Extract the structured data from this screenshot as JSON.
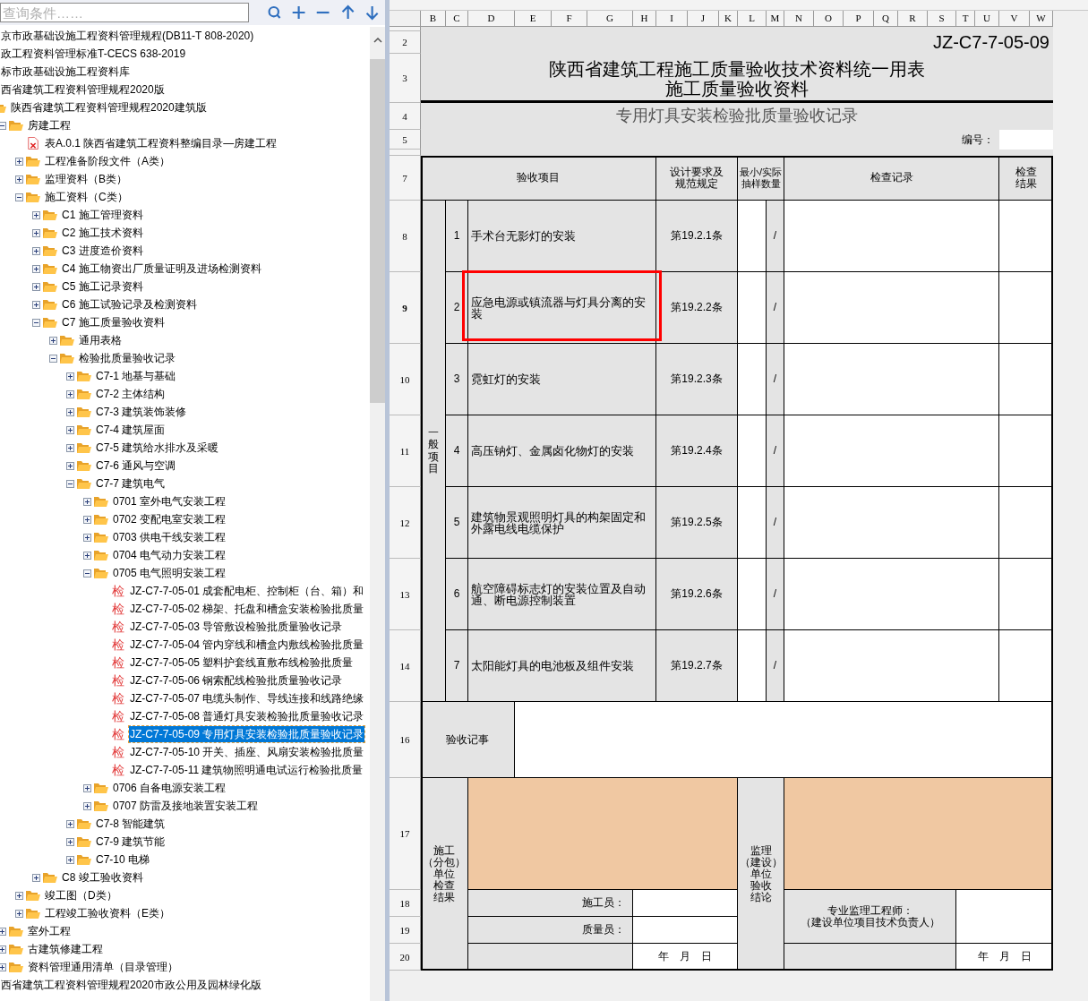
{
  "search": {
    "placeholder": "查询条件……"
  },
  "tree": [
    {
      "kind": "root",
      "label": "京市政基础设施工程资料管理规程(DB11-T 808-2020)",
      "selected": false
    },
    {
      "kind": "root",
      "label": "政工程资料管理标准T-CECS 638-2019",
      "selected": false
    },
    {
      "kind": "root",
      "label": "标市政基础设施工程资料库",
      "selected": false
    },
    {
      "kind": "root",
      "label": "西省建筑工程资料管理规程2020版",
      "selected": false
    },
    {
      "kind": "folder",
      "label": "陕西省建筑工程资料管理规程2020建筑版",
      "selected": false,
      "children": [
        {
          "kind": "folder",
          "label": "房建工程",
          "expanded": true,
          "selected": false,
          "children": [
            {
              "kind": "file",
              "label": "表A.0.1 陕西省建筑工程资料整编目录—房建工程",
              "selected": false
            },
            {
              "kind": "folder",
              "label": "工程准备阶段文件（A类）",
              "expanded": false,
              "selected": false
            },
            {
              "kind": "folder",
              "label": "监理资料（B类）",
              "expanded": false,
              "selected": false
            },
            {
              "kind": "folder",
              "label": "施工资料（C类）",
              "expanded": true,
              "selected": false,
              "children": [
                {
                  "kind": "folder",
                  "label": "C1 施工管理资料",
                  "expanded": false,
                  "selected": false
                },
                {
                  "kind": "folder",
                  "label": "C2 施工技术资料",
                  "expanded": false,
                  "selected": false
                },
                {
                  "kind": "folder",
                  "label": "C3 进度造价资料",
                  "expanded": false,
                  "selected": false
                },
                {
                  "kind": "folder",
                  "label": "C4 施工物资出厂质量证明及进场检测资料",
                  "expanded": false,
                  "selected": false
                },
                {
                  "kind": "folder",
                  "label": "C5 施工记录资料",
                  "expanded": false,
                  "selected": false
                },
                {
                  "kind": "folder",
                  "label": "C6 施工试验记录及检测资料",
                  "expanded": false,
                  "selected": false
                },
                {
                  "kind": "folder",
                  "label": "C7 施工质量验收资料",
                  "expanded": true,
                  "selected": false,
                  "children": [
                    {
                      "kind": "folder",
                      "label": "通用表格",
                      "expanded": false,
                      "selected": false
                    },
                    {
                      "kind": "folder",
                      "label": "检验批质量验收记录",
                      "expanded": true,
                      "selected": false,
                      "children": [
                        {
                          "kind": "folder",
                          "label": "C7-1 地基与基础",
                          "expanded": false,
                          "selected": false
                        },
                        {
                          "kind": "folder",
                          "label": "C7-2 主体结构",
                          "expanded": false,
                          "selected": false
                        },
                        {
                          "kind": "folder",
                          "label": "C7-3 建筑装饰装修",
                          "expanded": false,
                          "selected": false
                        },
                        {
                          "kind": "folder",
                          "label": "C7-4 建筑屋面",
                          "expanded": false,
                          "selected": false
                        },
                        {
                          "kind": "folder",
                          "label": "C7-5 建筑给水排水及采暖",
                          "expanded": false,
                          "selected": false
                        },
                        {
                          "kind": "folder",
                          "label": "C7-6 通风与空调",
                          "expanded": false,
                          "selected": false
                        },
                        {
                          "kind": "folder",
                          "label": "C7-7 建筑电气",
                          "expanded": true,
                          "selected": false,
                          "children": [
                            {
                              "kind": "folder",
                              "label": "0701 室外电气安装工程",
                              "expanded": false,
                              "selected": false
                            },
                            {
                              "kind": "folder",
                              "label": "0702 变配电室安装工程",
                              "expanded": false,
                              "selected": false
                            },
                            {
                              "kind": "folder",
                              "label": "0703 供电干线安装工程",
                              "expanded": false,
                              "selected": false
                            },
                            {
                              "kind": "folder",
                              "label": "0704 电气动力安装工程",
                              "expanded": false,
                              "selected": false
                            },
                            {
                              "kind": "folder",
                              "label": "0705 电气照明安装工程",
                              "expanded": true,
                              "selected": false,
                              "children": [
                                {
                                  "kind": "check",
                                  "badge": "检",
                                  "label": "JZ-C7-7-05-01 成套配电柜、控制柜（台、箱）和",
                                  "selected": false
                                },
                                {
                                  "kind": "check",
                                  "badge": "检",
                                  "label": "JZ-C7-7-05-02 梯架、托盘和槽盒安装检验批质量",
                                  "selected": false
                                },
                                {
                                  "kind": "check",
                                  "badge": "检",
                                  "label": "JZ-C7-7-05-03 导管敷设检验批质量验收记录",
                                  "selected": false
                                },
                                {
                                  "kind": "check",
                                  "badge": "检",
                                  "label": "JZ-C7-7-05-04 管内穿线和槽盒内敷线检验批质量",
                                  "selected": false
                                },
                                {
                                  "kind": "check",
                                  "badge": "检",
                                  "label": "JZ-C7-7-05-05 塑料护套线直敷布线检验批质量",
                                  "selected": false
                                },
                                {
                                  "kind": "check",
                                  "badge": "检",
                                  "label": "JZ-C7-7-05-06 钢索配线检验批质量验收记录",
                                  "selected": false
                                },
                                {
                                  "kind": "check",
                                  "badge": "检",
                                  "label": "JZ-C7-7-05-07 电缆头制作、导线连接和线路绝缘",
                                  "selected": false
                                },
                                {
                                  "kind": "check",
                                  "badge": "检",
                                  "label": "JZ-C7-7-05-08 普通灯具安装检验批质量验收记录",
                                  "selected": false
                                },
                                {
                                  "kind": "check",
                                  "badge": "检",
                                  "label": "JZ-C7-7-05-09 专用灯具安装检验批质量验收记录",
                                  "selected": true
                                },
                                {
                                  "kind": "check",
                                  "badge": "检",
                                  "label": "JZ-C7-7-05-10 开关、插座、风扇安装检验批质量",
                                  "selected": false
                                },
                                {
                                  "kind": "check",
                                  "badge": "检",
                                  "label": "JZ-C7-7-05-11 建筑物照明通电试运行检验批质量",
                                  "selected": false
                                }
                              ]
                            },
                            {
                              "kind": "folder",
                              "label": "0706 自备电源安装工程",
                              "expanded": false,
                              "selected": false
                            },
                            {
                              "kind": "folder",
                              "label": "0707 防雷及接地装置安装工程",
                              "expanded": false,
                              "selected": false
                            }
                          ]
                        },
                        {
                          "kind": "folder",
                          "label": "C7-8 智能建筑",
                          "expanded": false,
                          "selected": false
                        },
                        {
                          "kind": "folder",
                          "label": "C7-9 建筑节能",
                          "expanded": false,
                          "selected": false
                        },
                        {
                          "kind": "folder",
                          "label": "C7-10 电梯",
                          "expanded": false,
                          "selected": false
                        }
                      ]
                    }
                  ]
                },
                {
                  "kind": "folder",
                  "label": "C8 竣工验收资料",
                  "expanded": false,
                  "selected": false
                }
              ]
            },
            {
              "kind": "folder",
              "label": "竣工图（D类）",
              "expanded": false,
              "selected": false
            },
            {
              "kind": "folder",
              "label": "工程竣工验收资料（E类）",
              "expanded": false,
              "selected": false
            }
          ]
        },
        {
          "kind": "folder",
          "label": "室外工程",
          "expanded": false,
          "selected": false
        },
        {
          "kind": "folder",
          "label": "古建筑修建工程",
          "expanded": false,
          "selected": false
        },
        {
          "kind": "folder",
          "label": "资料管理通用清单（目录管理）",
          "expanded": false,
          "selected": false
        }
      ]
    },
    {
      "kind": "root",
      "label": "西省建筑工程资料管理规程2020市政公用及园林绿化版",
      "selected": false
    }
  ],
  "sheet": {
    "column_headers": [
      "B",
      "C",
      "D",
      "E",
      "F",
      "G",
      "H",
      "I",
      "J",
      "K",
      "L",
      "M",
      "N",
      "O",
      "P",
      "Q",
      "R",
      "S",
      "T",
      "U",
      "V",
      "W"
    ],
    "row_headers": [
      {
        "label": "2",
        "selected": false
      },
      {
        "label": "3",
        "selected": false
      },
      {
        "label": "4",
        "selected": false
      },
      {
        "label": "5",
        "selected": false
      },
      {
        "label": "7",
        "selected": false
      },
      {
        "label": "8",
        "selected": false
      },
      {
        "label": "9",
        "selected": true
      },
      {
        "label": "10",
        "selected": false
      },
      {
        "label": "11",
        "selected": false
      },
      {
        "label": "12",
        "selected": false
      },
      {
        "label": "13",
        "selected": false
      },
      {
        "label": "14",
        "selected": false
      },
      {
        "label": "16",
        "selected": false
      },
      {
        "label": "17",
        "selected": false
      },
      {
        "label": "18",
        "selected": false
      },
      {
        "label": "19",
        "selected": false
      },
      {
        "label": "20",
        "selected": false
      }
    ],
    "form_code": "JZ-C7-7-05-09",
    "title_lines": [
      "陕西省建筑工程施工质量验收技术资料统一用表",
      "施工质量验收资料"
    ],
    "subtitle": "专用灯具安装检验批质量验收记录",
    "number_label": "编号：",
    "table_header": {
      "item": "验收项目",
      "design_lines": [
        "设计要求及",
        "规范规定"
      ],
      "sample_lines": [
        "最小/实际",
        "抽样数量"
      ],
      "record": "检查记录",
      "result_lines": [
        "检查",
        "结果"
      ]
    },
    "group_label": "一般项目",
    "items": [
      {
        "index": "1",
        "name": "手术台无影灯的安装",
        "clause": "第19.2.1条",
        "sample": "/",
        "highlighted": false
      },
      {
        "index": "2",
        "name": "应急电源或镇流器与灯具分离的安装",
        "clause": "第19.2.2条",
        "sample": "/",
        "highlighted": true
      },
      {
        "index": "3",
        "name": "霓虹灯的安装",
        "clause": "第19.2.3条",
        "sample": "/",
        "highlighted": false
      },
      {
        "index": "4",
        "name": "高压钠灯、金属卤化物灯的安装",
        "clause": "第19.2.4条",
        "sample": "/",
        "highlighted": false
      },
      {
        "index": "5",
        "name": "建筑物景观照明灯具的构架固定和外露电线电缆保护",
        "clause": "第19.2.5条",
        "sample": "/",
        "highlighted": false
      },
      {
        "index": "6",
        "name": "航空障碍标志灯的安装位置及自动通、断电源控制装置",
        "clause": "第19.2.6条",
        "sample": "/",
        "highlighted": false
      },
      {
        "index": "7",
        "name": "太阳能灯具的电池板及组件安装",
        "clause": "第19.2.7条",
        "sample": "/",
        "highlighted": false
      }
    ],
    "notes_label": "验收记事",
    "contractor": {
      "label_lines": [
        "施工",
        "（分包）",
        "单位",
        "检查",
        "结果"
      ],
      "inspector_label": "施工员：",
      "quality_label": "质量员：",
      "date": "年　月　日"
    },
    "supervisor": {
      "label_lines": [
        "监理",
        "（建设）",
        "单位",
        "验收",
        "结论"
      ],
      "engineer_lines": [
        "专业监理工程师：",
        "（建设单位项目技术负责人）"
      ],
      "date": "年　月　日"
    }
  }
}
